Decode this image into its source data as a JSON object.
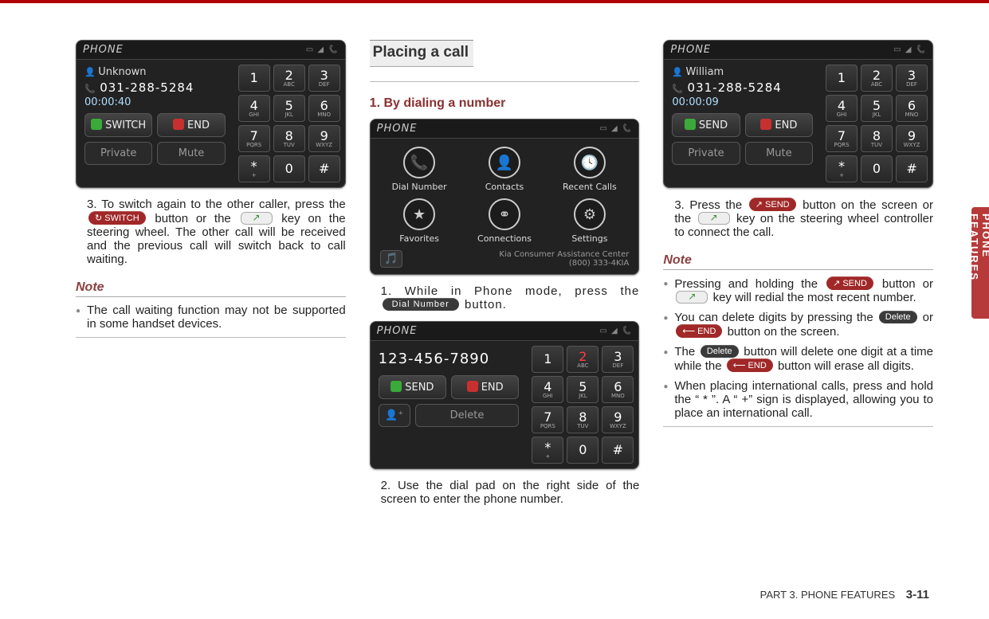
{
  "side_tab": "PHONE FEATURES",
  "footer": {
    "part": "PART 3. PHONE FEATURES",
    "page": "3-11"
  },
  "col1": {
    "shot": {
      "title": "PHONE",
      "caller": "Unknown",
      "number": "031-288-5284",
      "time": "00:00:40",
      "btn_switch": "SWITCH",
      "btn_end": "END",
      "btn_private": "Private",
      "btn_mute": "Mute"
    },
    "step3_pre": "3. To switch again to the other caller, press the ",
    "chip_switch": "↻ SWITCH",
    "step3_mid": " button or the ",
    "step3_post": " key on the steering wheel. The other call will be received and the previous call will switch back to call waiting.",
    "note_hd": "Note",
    "note1": "The call waiting function may not be supported in some handset devices."
  },
  "col2": {
    "section": "Placing a call",
    "sub1": "1. By dialing a number",
    "menu": {
      "title": "PHONE",
      "items": [
        "Dial Number",
        "Contacts",
        "Recent Calls",
        "Favorites",
        "Connections",
        "Settings"
      ],
      "footer_line1": "Kia Consumer Assistance Center",
      "footer_line2": "(800) 333-4KIA"
    },
    "step1_pre": "1. While in Phone mode, press the ",
    "chip_dial": "Dial Number",
    "step1_post": " button.",
    "dial_shot": {
      "title": "PHONE",
      "input": "123-456-7890",
      "btn_send": "SEND",
      "btn_end": "END",
      "btn_delete": "Delete"
    },
    "step2": "2. Use the dial pad on the right side of the screen to enter the phone number."
  },
  "col3": {
    "shot": {
      "title": "PHONE",
      "caller": "William",
      "number": "031-288-5284",
      "time": "00:00:09",
      "btn_send": "SEND",
      "btn_end": "END",
      "btn_private": "Private",
      "btn_mute": "Mute"
    },
    "step3_pre": "3. Press the ",
    "chip_send": "↗ SEND",
    "step3_mid": " button on the screen or the ",
    "step3_post": " key on the steering wheel controller to connect the call.",
    "note_hd": "Note",
    "n1_pre": "Pressing and holding the ",
    "n1_chip": "↗ SEND",
    "n1_mid": " button or ",
    "n1_post": " key will redial the most recent number.",
    "n2_pre": "You can delete digits by pressing the ",
    "n2_chip1": "Delete",
    "n2_mid": " or ",
    "n2_chip2": "⟵ END",
    "n2_post": " button on the screen.",
    "n3_pre": "The ",
    "n3_chip1": "Delete",
    "n3_mid": " button will delete one digit at a time while the ",
    "n3_chip2": "⟵ END",
    "n3_post": " button will erase all digits.",
    "n4": "When placing international calls, press and hold the “ * ”. A “ +” sign is displayed, allowing you to place an international call."
  },
  "keypad": [
    {
      "d": "1",
      "l": ""
    },
    {
      "d": "2",
      "l": "ABC"
    },
    {
      "d": "3",
      "l": "DEF"
    },
    {
      "d": "4",
      "l": "GHI"
    },
    {
      "d": "5",
      "l": "JKL"
    },
    {
      "d": "6",
      "l": "MNO"
    },
    {
      "d": "7",
      "l": "PQRS"
    },
    {
      "d": "8",
      "l": "TUV"
    },
    {
      "d": "9",
      "l": "WXYZ"
    },
    {
      "d": "*",
      "l": "+"
    },
    {
      "d": "0",
      "l": ""
    },
    {
      "d": "#",
      "l": ""
    }
  ]
}
